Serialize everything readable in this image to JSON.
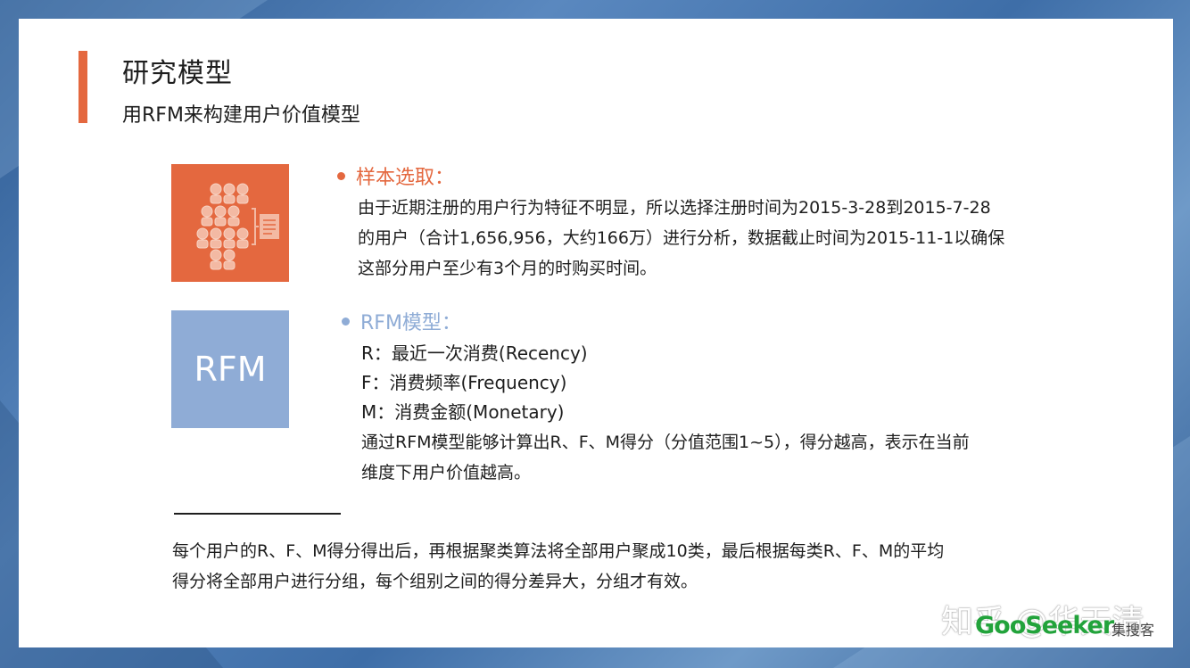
{
  "slide": {
    "title": "研究模型",
    "subtitle": "用RFM来构建用户价值模型"
  },
  "section1": {
    "heading": "样本选取：",
    "icon": "people-document-icon",
    "lines": [
      "由于近期注册的用户行为特征不明显，所以选择注册时间为2015-3-28到2015-7-28",
      "的用户（合计1,656,956，大约166万）进行分析，数据截止时间为2015-11-1以确保",
      "这部分用户至少有3个月的时购买时间。"
    ]
  },
  "section2": {
    "heading": "RFM模型：",
    "tile_label": "RFM",
    "r": "R：最近一次消费(Recency)",
    "f": "F：消费频率(Frequency)",
    "m": "M：消费金额(Monetary)",
    "lines": [
      "通过RFM模型能够计算出R、F、M得分（分值范围1~5），得分越高，表示在当前",
      "维度下用户价值越高。"
    ]
  },
  "footer": {
    "lines": [
      "每个用户的R、F、M得分得出后，再根据聚类算法将全部用户聚成10类，最后根据每类R、F、M的平均",
      "得分将全部用户进行分组，每个组别之间的得分差异大，分组才有效。"
    ]
  },
  "watermark": "知乎 @华天清",
  "brand": {
    "name": "GooSeeker",
    "sub": "集搜客"
  },
  "colors": {
    "accent_orange": "#e4683f",
    "accent_blue": "#8facd6",
    "brand_green": "#22a33b"
  }
}
